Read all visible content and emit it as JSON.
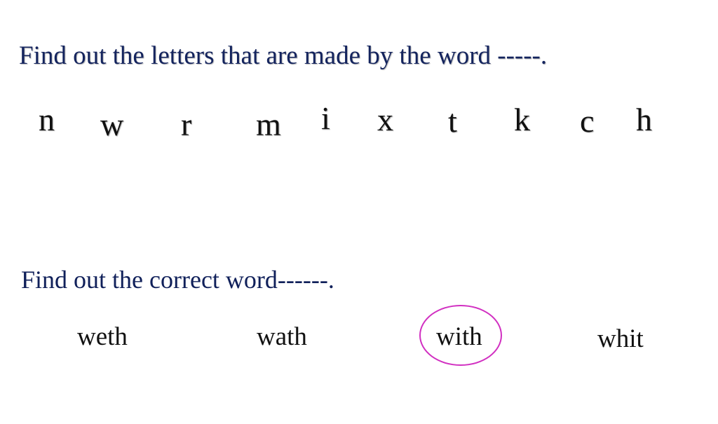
{
  "section1": {
    "instruction": "Find out the letters that are made by the word -----.",
    "letters": [
      "n",
      "w",
      "r",
      "m",
      "i",
      "x",
      "t",
      "k",
      "c",
      "h"
    ]
  },
  "section2": {
    "instruction": "Find out the correct word------.",
    "options": [
      "weth",
      "wath",
      "with",
      "whit"
    ],
    "circled_option": "with"
  },
  "colors": {
    "heading": "#14245e",
    "circle": "#d12fc1"
  }
}
